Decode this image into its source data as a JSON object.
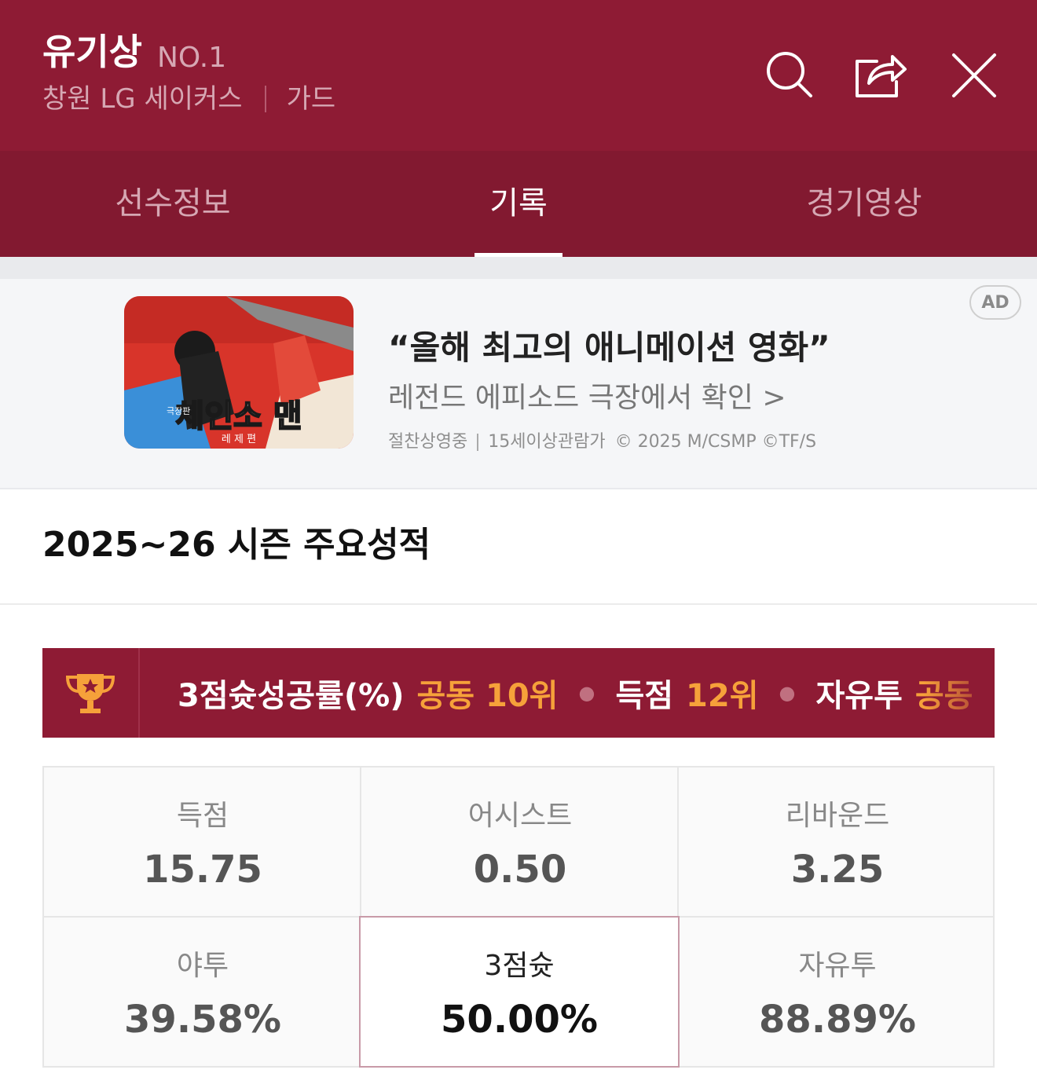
{
  "header": {
    "player_name": "유기상",
    "player_number": "NO.1",
    "team": "창원 LG 세이커스",
    "position": "가드",
    "icons": [
      "search-icon",
      "share-icon",
      "close-icon"
    ]
  },
  "tabs": [
    {
      "label": "선수정보",
      "active": false
    },
    {
      "label": "기록",
      "active": true
    },
    {
      "label": "경기영상",
      "active": false
    }
  ],
  "ad": {
    "headline": "“올해 최고의 애니메이션 영화”",
    "sub": "레전드 에피소드 극장에서 확인 >",
    "meta_status": "절찬상영중",
    "meta_rating": "15세이상관람가",
    "meta_copyright": "© 2025 M/CSMP ©TF/S",
    "badge": "AD",
    "thumb_title": "체인소 맨",
    "thumb_subtitle": "레 제 편",
    "thumb_side": "극장판"
  },
  "season": {
    "title": "2025~26 시즌 주요성적"
  },
  "rankings": [
    {
      "category": "3점슛성공률(%)",
      "rank": "공동 10위"
    },
    {
      "category": "득점",
      "rank": "12위"
    },
    {
      "category": "자유투",
      "rank": "공동"
    }
  ],
  "stats": [
    {
      "label": "득점",
      "value": "15.75"
    },
    {
      "label": "어시스트",
      "value": "0.50"
    },
    {
      "label": "리바운드",
      "value": "3.25"
    },
    {
      "label": "야투",
      "value": "39.58%"
    },
    {
      "label": "3점슛",
      "value": "50.00%"
    },
    {
      "label": "자유투",
      "value": "88.89%"
    }
  ],
  "colors": {
    "header_bg": "#8e1b34",
    "tab_bg": "#821930",
    "rank_accent": "#f6a13a",
    "highlight_border": "#c89aa8"
  }
}
